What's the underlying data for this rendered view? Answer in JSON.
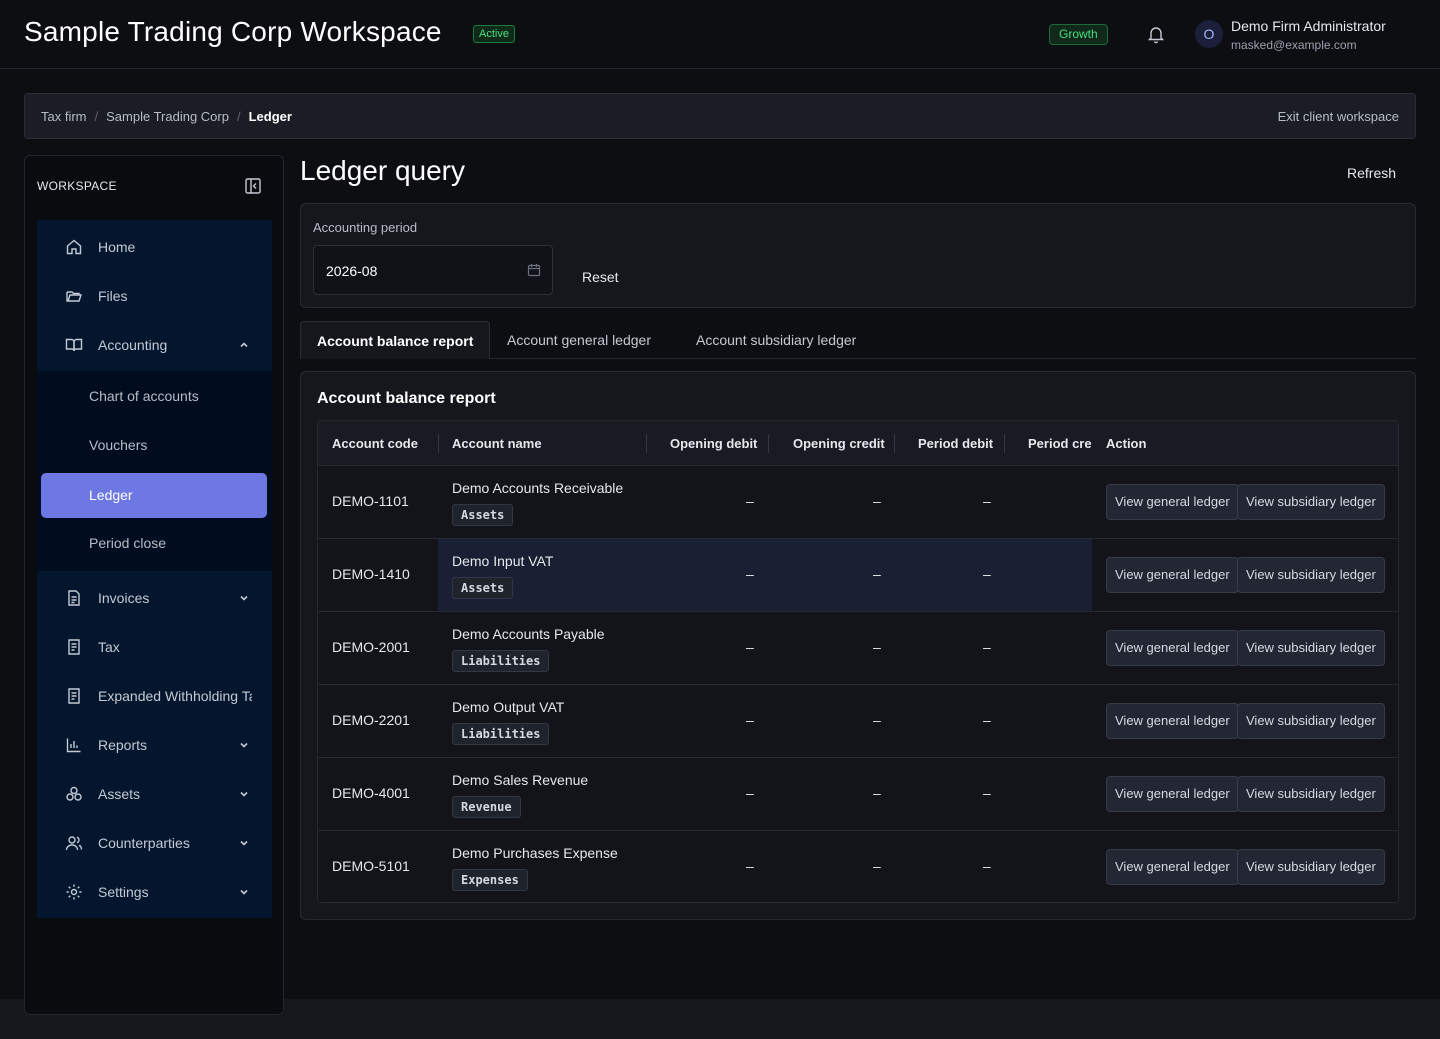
{
  "header": {
    "title": "Sample Trading Corp Workspace",
    "status": "Active",
    "plan": "Growth",
    "user_initial": "O",
    "user_name": "Demo Firm Administrator",
    "user_email": "masked@example.com"
  },
  "breadcrumb": {
    "items": [
      "Tax firm",
      "Sample Trading Corp",
      "Ledger"
    ],
    "exit_label": "Exit client workspace"
  },
  "sidebar": {
    "heading": "WORKSPACE",
    "items": [
      {
        "label": "Home",
        "icon": "home-icon"
      },
      {
        "label": "Files",
        "icon": "folder-icon"
      },
      {
        "label": "Accounting",
        "icon": "book-icon",
        "expanded": true
      },
      {
        "label": "Invoices",
        "icon": "document-icon"
      },
      {
        "label": "Tax",
        "icon": "receipt-icon"
      },
      {
        "label": "Expanded Withholding Tax",
        "icon": "receipt-icon"
      },
      {
        "label": "Reports",
        "icon": "bar-chart-icon"
      },
      {
        "label": "Assets",
        "icon": "assets-icon"
      },
      {
        "label": "Counterparties",
        "icon": "users-icon"
      },
      {
        "label": "Settings",
        "icon": "gear-icon"
      }
    ],
    "accounting_sub": [
      {
        "label": "Chart of accounts"
      },
      {
        "label": "Vouchers"
      },
      {
        "label": "Ledger",
        "active": true
      },
      {
        "label": "Period close"
      }
    ]
  },
  "main": {
    "title": "Ledger query",
    "refresh_label": "Refresh",
    "filter": {
      "period_label": "Accounting period",
      "period_value": "2026-08",
      "reset_label": "Reset"
    },
    "tabs": [
      "Account balance report",
      "Account general ledger",
      "Account subsidiary ledger"
    ],
    "active_tab": 0
  },
  "report": {
    "title": "Account balance report",
    "columns": [
      "Account code",
      "Account name",
      "Opening debit",
      "Opening credit",
      "Period debit",
      "Period credit",
      "Action"
    ],
    "rows": [
      {
        "code": "DEMO-1101",
        "name": "Demo Accounts Receivable",
        "category": "Assets",
        "opening_debit": "–",
        "opening_credit": "–",
        "period_debit": "–",
        "period_credit": ""
      },
      {
        "code": "DEMO-1410",
        "name": "Demo Input VAT",
        "category": "Assets",
        "opening_debit": "–",
        "opening_credit": "–",
        "period_debit": "–",
        "period_credit": ""
      },
      {
        "code": "DEMO-2001",
        "name": "Demo Accounts Payable",
        "category": "Liabilities",
        "opening_debit": "–",
        "opening_credit": "–",
        "period_debit": "–",
        "period_credit": ""
      },
      {
        "code": "DEMO-2201",
        "name": "Demo Output VAT",
        "category": "Liabilities",
        "opening_debit": "–",
        "opening_credit": "–",
        "period_debit": "–",
        "period_credit": ""
      },
      {
        "code": "DEMO-4001",
        "name": "Demo Sales Revenue",
        "category": "Revenue",
        "opening_debit": "–",
        "opening_credit": "–",
        "period_debit": "–",
        "period_credit": ""
      },
      {
        "code": "DEMO-5101",
        "name": "Demo Purchases Expense",
        "category": "Expenses",
        "opening_debit": "–",
        "opening_credit": "–",
        "period_debit": "–",
        "period_credit": ""
      }
    ],
    "actions": {
      "general": "View general ledger",
      "subsidiary": "View subsidiary ledger"
    }
  }
}
